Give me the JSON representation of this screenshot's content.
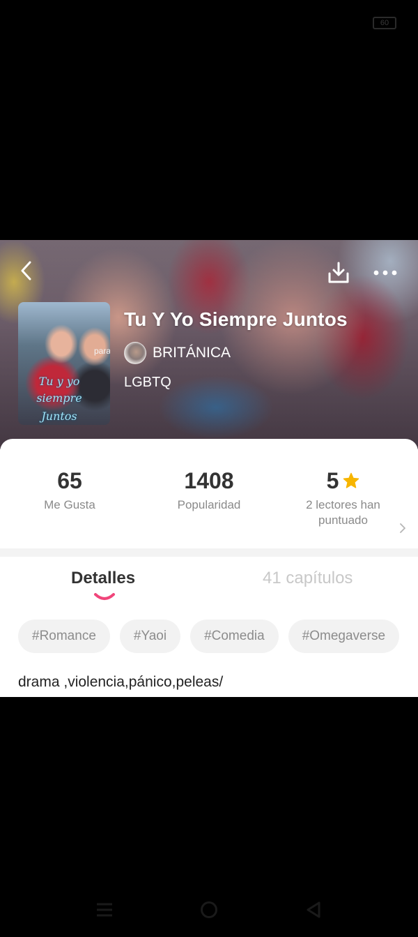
{
  "status_bar": {
    "battery": "60"
  },
  "header": {
    "icons": {
      "back": "chevron-left-icon",
      "download": "download-icon",
      "more": "more-dots-icon"
    }
  },
  "cover": {
    "overlay_text": "para",
    "script_lines": [
      "Tu y yo",
      "siempre",
      "Juntos"
    ]
  },
  "book": {
    "title": "Tu Y Yo Siempre Juntos",
    "author": "BRITÁNICA",
    "genre": "LGBTQ"
  },
  "stats": {
    "likes": {
      "value": "65",
      "label": "Me Gusta"
    },
    "popularity": {
      "value": "1408",
      "label": "Popularidad"
    },
    "rating": {
      "value": "5",
      "label_line1": "2 lectores han",
      "label_line2": "puntuado"
    }
  },
  "tabs": {
    "details": "Detalles",
    "chapters": "41 capítulos",
    "active": "details"
  },
  "tags": [
    "#Romance",
    "#Yaoi",
    "#Comedia",
    "#Omegaverse"
  ],
  "description": "drama ,violencia,pánico,peleas/",
  "colors": {
    "accent_pink": "#f0457a",
    "star_yellow": "#f7b500",
    "text_dark": "#333333",
    "text_muted": "#8a8a8a",
    "tag_bg": "#f2f2f2"
  },
  "system_nav": {
    "icons": [
      "menu-icon",
      "home-icon",
      "back-triangle-icon"
    ]
  }
}
